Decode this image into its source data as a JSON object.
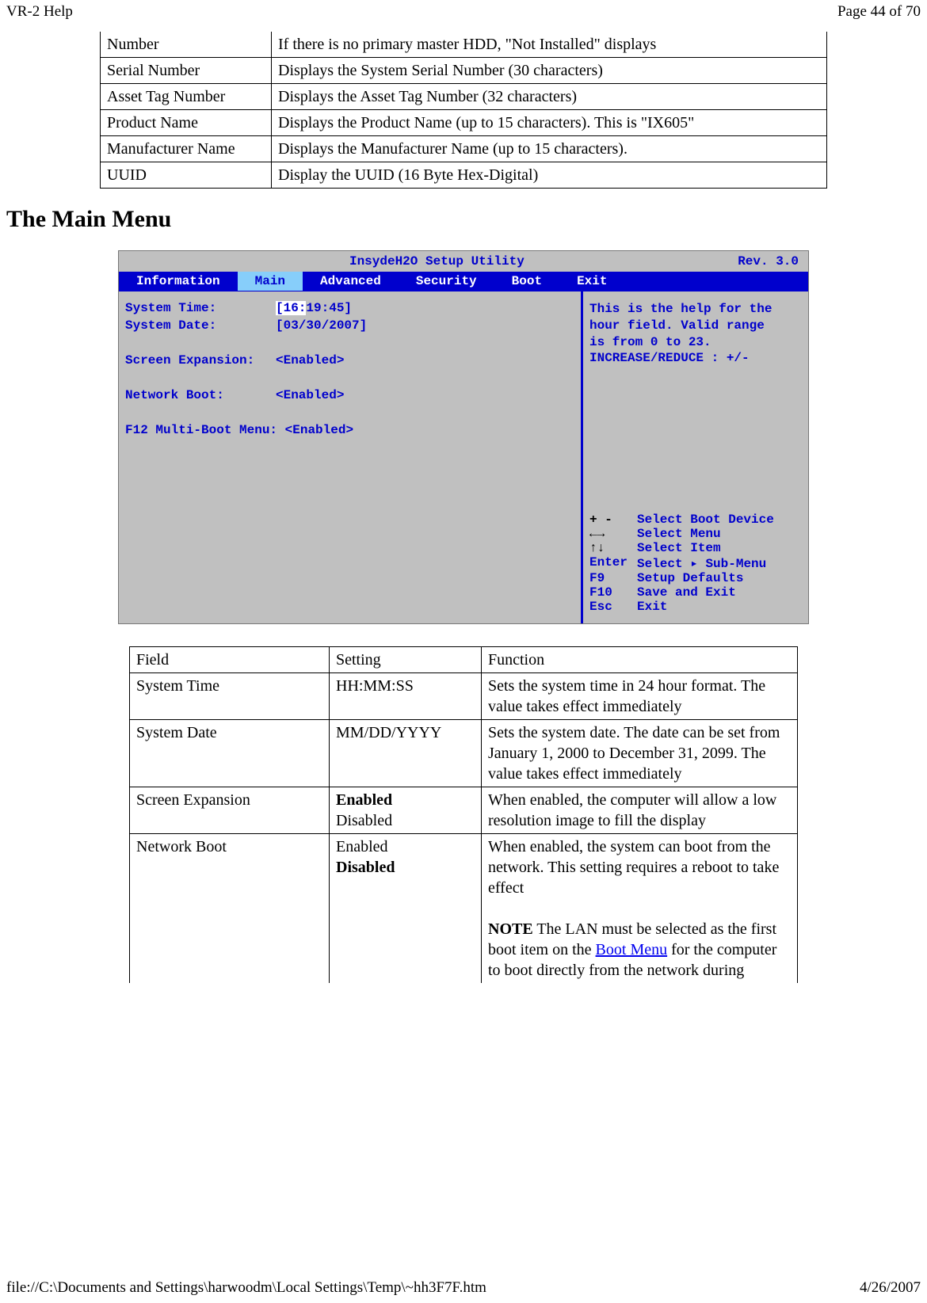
{
  "header": {
    "left": "VR-2 Help",
    "right": "Page 44 of 70"
  },
  "footer": {
    "left": "file://C:\\Documents and Settings\\harwoodm\\Local Settings\\Temp\\~hh3F7F.htm",
    "right": "4/26/2007"
  },
  "table1": {
    "rows": [
      {
        "c1": "Number",
        "c2": "If there is  no primary master HDD, \"Not Installed\" displays"
      },
      {
        "c1": "Serial Number",
        "c2": "Displays the System Serial Number (30 characters)"
      },
      {
        "c1": "Asset Tag Number",
        "c2": "Displays the Asset Tag Number (32 characters)"
      },
      {
        "c1": "Product Name",
        "c2": "Displays the Product Name (up to 15 characters). This is  \"IX605\""
      },
      {
        "c1": "Manufacturer Name",
        "c2": "Displays the Manufacturer Name (up to 15 characters)."
      },
      {
        "c1": "UUID",
        "c2": "Display the UUID (16 Byte Hex-Digital)"
      }
    ]
  },
  "section_title": "The Main Menu",
  "bios": {
    "title_center": "InsydeH2O Setup Utility",
    "title_right": "Rev. 3.0",
    "tabs": [
      "Information",
      "Main",
      "Advanced",
      "Security",
      "Boot",
      "Exit"
    ],
    "active_tab": "Main",
    "left": {
      "r0_lbl": "System Time:",
      "r0_hr": "[16:",
      "r0_rest": "19:45]",
      "r1_lbl": "System Date:",
      "r1_val": "[03/30/2007]",
      "r2_lbl": "Screen Expansion:",
      "r2_val": "<Enabled>",
      "r3_lbl": "Network Boot:",
      "r3_val": "<Enabled>",
      "r4_full": "F12 Multi-Boot Menu: <Enabled>"
    },
    "help_top_l1": "This is the help for the",
    "help_top_l2": "hour field.  Valid range",
    "help_top_l3": "is from 0 to 23.",
    "help_top_l4": "INCREASE/REDUCE : +/-",
    "keys": [
      {
        "k": "+ -",
        "d": "Select Boot Device"
      },
      {
        "k": "←→",
        "d": "Select Menu"
      },
      {
        "k": "↑↓",
        "d": "Select Item"
      },
      {
        "k": "Enter",
        "d": "Select ▸ Sub-Menu"
      },
      {
        "k": "F9",
        "d": "Setup Defaults"
      },
      {
        "k": "F10",
        "d": "Save and Exit"
      },
      {
        "k": "Esc",
        "d": "Exit"
      }
    ]
  },
  "table2": {
    "header": {
      "c1": "Field",
      "c2": "Setting",
      "c3": "Function"
    },
    "rows": [
      {
        "c1": "System Time",
        "c2": "HH:MM:SS",
        "c3": "Sets the system time in 24 hour format. The value takes effect immediately"
      },
      {
        "c1": "System Date",
        "c2": "MM/DD/YYYY",
        "c3": "Sets the system date. The date can be set from January 1, 2000 to December 31, 2099. The value takes effect immediately"
      },
      {
        "c1": "Screen Expansion",
        "c2_bold": "Enabled",
        "c2_plain": "Disabled",
        "c3": "When enabled, the computer will allow a low resolution image to fill the display"
      },
      {
        "c1": "Network Boot",
        "c2_plain_top": "Enabled",
        "c2_bold": "Disabled",
        "c3_p1": "When enabled, the system can boot from the network. This setting requires a reboot to take effect",
        "c3_note_label": "NOTE",
        "c3_note_pre": "  The LAN must be selected as the first boot item on the ",
        "c3_link": "Boot Menu",
        "c3_note_post": " for the computer to boot directly from the network during"
      }
    ]
  }
}
